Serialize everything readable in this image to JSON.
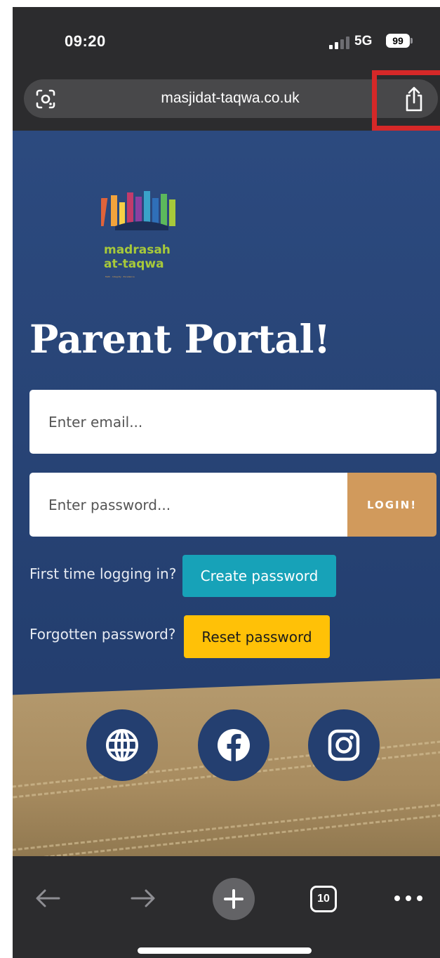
{
  "status_bar": {
    "time": "09:20",
    "network": "5G",
    "battery": "99"
  },
  "browser": {
    "url": "masjidat-taqwa.co.uk"
  },
  "logo": {
    "line1": "madrasah",
    "line2": "at-taqwa",
    "tagline": "Faith · Integrity · Excellence"
  },
  "page": {
    "title": "Parent Portal!",
    "email_placeholder": "Enter email...",
    "password_placeholder": "Enter password...",
    "login_label": "LOGIN!",
    "first_time_label": "First time logging in?",
    "create_password_label": "Create password",
    "forgotten_label": "Forgotten password?",
    "reset_password_label": "Reset password"
  },
  "social": [
    "globe-icon",
    "facebook-icon",
    "instagram-icon"
  ],
  "toolbar": {
    "tab_count": "10"
  },
  "colors": {
    "page_bg": "#284476",
    "login": "#d19a5c",
    "create": "#17a2b8",
    "reset": "#ffc107",
    "highlight": "#d62828",
    "logo_text": "#a7c93a"
  }
}
